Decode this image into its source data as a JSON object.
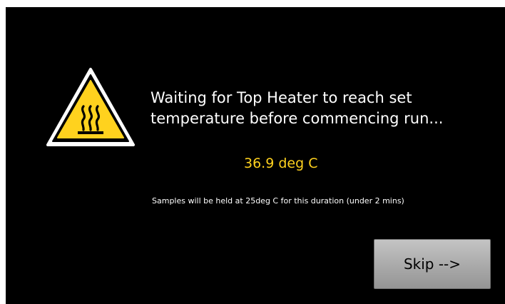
{
  "dialog": {
    "message_line1": "Waiting for Top Heater to reach set",
    "message_line2": "temperature before commencing run...",
    "temperature": "36.9 deg C",
    "note": "Samples will be held at 25deg C for this duration (under 2 mins)",
    "skip_label": "Skip -->",
    "icon": "hot-surface-warning-icon"
  },
  "colors": {
    "background": "#000000",
    "text": "#ffffff",
    "temperature": "#ffd21e",
    "warning_yellow": "#ffd21e"
  }
}
